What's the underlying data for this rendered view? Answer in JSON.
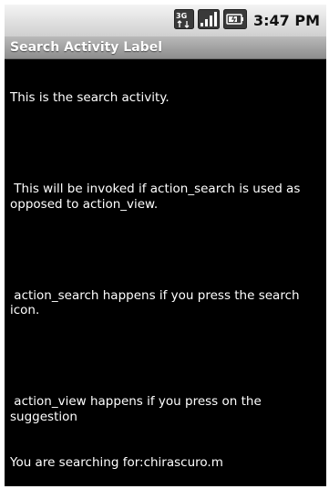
{
  "status_bar": {
    "network_icon": "3g-data-icon",
    "signal_icon": "signal-strength-icon",
    "battery_icon": "battery-icon",
    "time": "3:47 PM"
  },
  "app": {
    "title": "Search Activity Label"
  },
  "content": {
    "paragraph_1": "This is the search activity.",
    "paragraph_2": " This will be invoked if action_search is used as opposed to action_view.",
    "paragraph_3": " action_search happens if you press the search icon.",
    "paragraph_4": " action_view happens if you press on the suggestion",
    "search_result": "You are searching for:chirascuro.m"
  },
  "colors": {
    "background": "#000000",
    "text": "#ffffff",
    "title_bar": "#a0a0a0",
    "status_bar": "#e0e0e0"
  }
}
